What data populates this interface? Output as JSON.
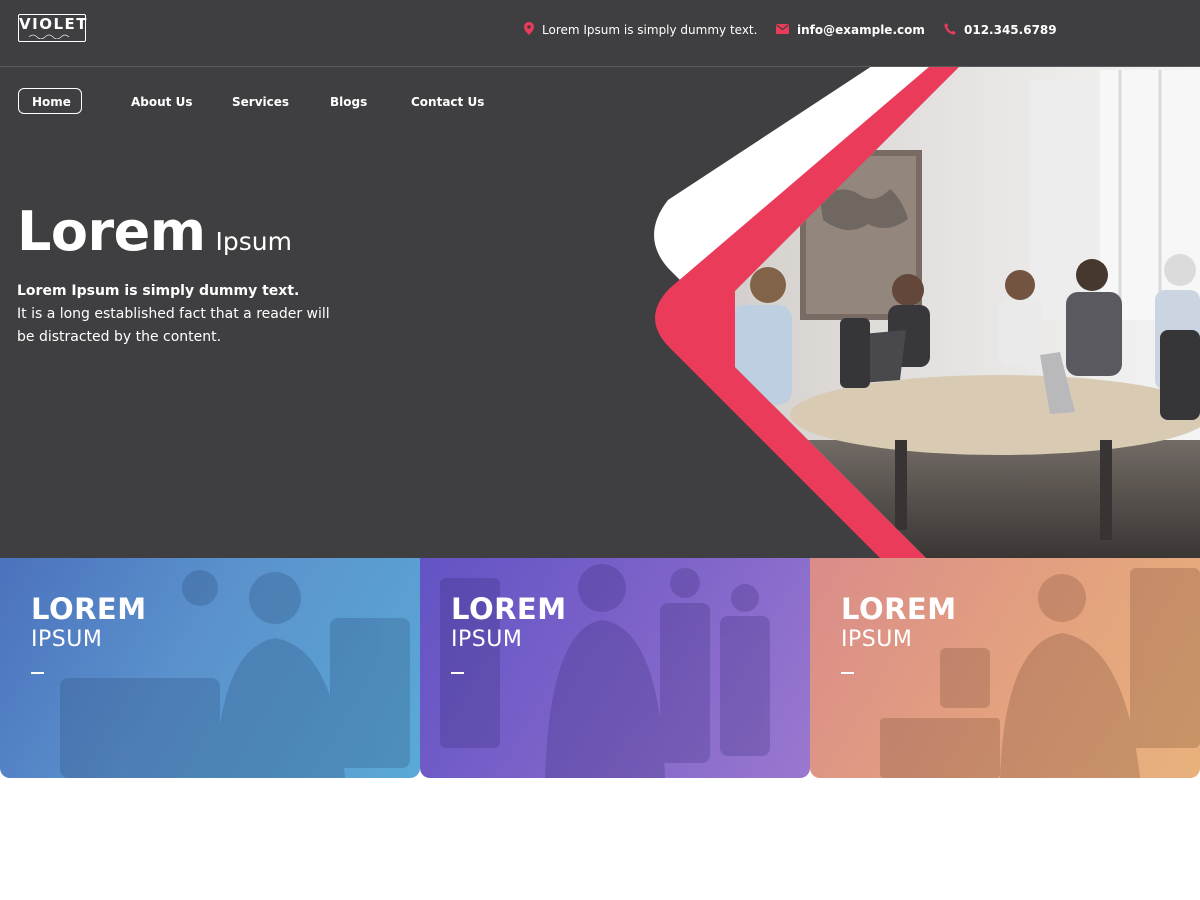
{
  "brand": {
    "logo_text": "VIOLET",
    "logo_script": "photography"
  },
  "contact": {
    "address": "Lorem Ipsum is simply dummy text.",
    "email": "info@example.com",
    "phone": "012.345.6789",
    "icons": [
      "location-pin-icon",
      "envelope-icon",
      "phone-icon"
    ]
  },
  "nav": {
    "items": [
      {
        "label": "Home",
        "active": true
      },
      {
        "label": "About Us",
        "active": false
      },
      {
        "label": "Services",
        "active": false
      },
      {
        "label": "Blogs",
        "active": false
      },
      {
        "label": "Contact Us",
        "active": false
      }
    ]
  },
  "hero": {
    "title_big": "Lorem",
    "title_small": "Ipsum",
    "tagline": "Lorem Ipsum is simply dummy text.",
    "body_line1": "It is a long established fact that a reader will",
    "body_line2": "be distracted by the content."
  },
  "cards": [
    {
      "title": "LOREM",
      "subtitle": "IPSUM",
      "dash": "—"
    },
    {
      "title": "LOREM",
      "subtitle": "IPSUM",
      "dash": "—"
    },
    {
      "title": "LOREM",
      "subtitle": "IPSUM",
      "dash": "—"
    }
  ],
  "colors": {
    "header_bg": "#3f3f41",
    "accent": "#ea3b5b",
    "card_blue": "#5b92cc",
    "card_purple": "#7d63c9",
    "card_peach": "#e3a07f"
  }
}
